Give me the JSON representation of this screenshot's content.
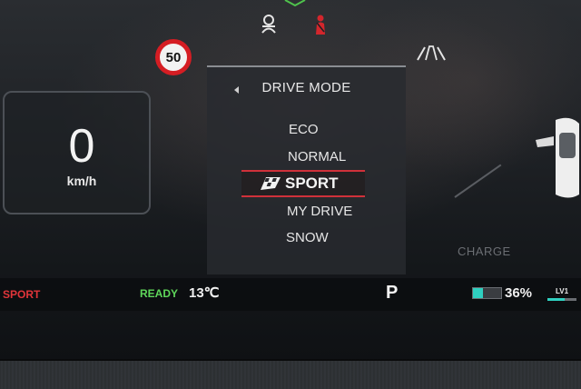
{
  "top_icons": [
    "driver-monitor-icon",
    "seatbelt-warning-icon",
    "lane-assist-icon"
  ],
  "speed_limit": "50",
  "speedometer": {
    "value": "0",
    "unit": "km/h"
  },
  "drive_mode_menu": {
    "title": "DRIVE MODE",
    "items": [
      "ECO",
      "NORMAL",
      "SPORT",
      "MY DRIVE",
      "SNOW"
    ],
    "selected": "SPORT"
  },
  "charge_label": "CHARGE",
  "status_bar": {
    "drive_mode": "SPORT",
    "ready": "READY",
    "temperature": "13℃",
    "gear": "P",
    "battery_percent": "36%",
    "battery_level": 0.36,
    "lv_label": "LV1"
  },
  "colors": {
    "sport_red": "#d0313a",
    "ready_green": "#5fd65a",
    "battery_teal": "#2fd0c0"
  }
}
